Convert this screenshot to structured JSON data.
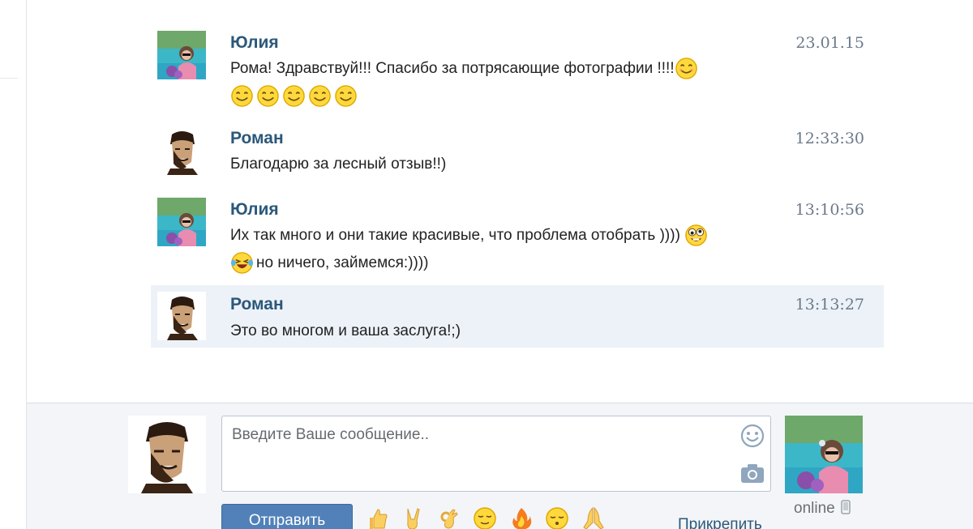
{
  "messages": [
    {
      "author": "Юлия",
      "time": "23.01.15",
      "line1": "Рома! Здравствуй!!! Спасибо за потрясающие фотографии !!!!",
      "avatar": "yulia-avatar"
    },
    {
      "author": "Роман",
      "time": "12:33:30",
      "line1": "Благодарю за лесный отзыв!!)",
      "avatar": "roman-avatar"
    },
    {
      "author": "Юлия",
      "time": "13:10:56",
      "line1": "Их так много и они такие красивые, что проблема отобрать ))))",
      "line2": "но ничего, займемся:))))",
      "avatar": "yulia-avatar"
    },
    {
      "author": "Роман",
      "time": "13:13:27",
      "line1": "Это во многом и ваша заслуга!;)",
      "avatar": "roman-avatar"
    }
  ],
  "composer": {
    "placeholder": "Введите Ваше сообщение..",
    "send_label": "Отправить",
    "attach_label": "Прикрепить",
    "status": "online"
  },
  "colors": {
    "author": "#2b587a",
    "highlight": "#edf2f8",
    "send_button": "#5181b8"
  }
}
